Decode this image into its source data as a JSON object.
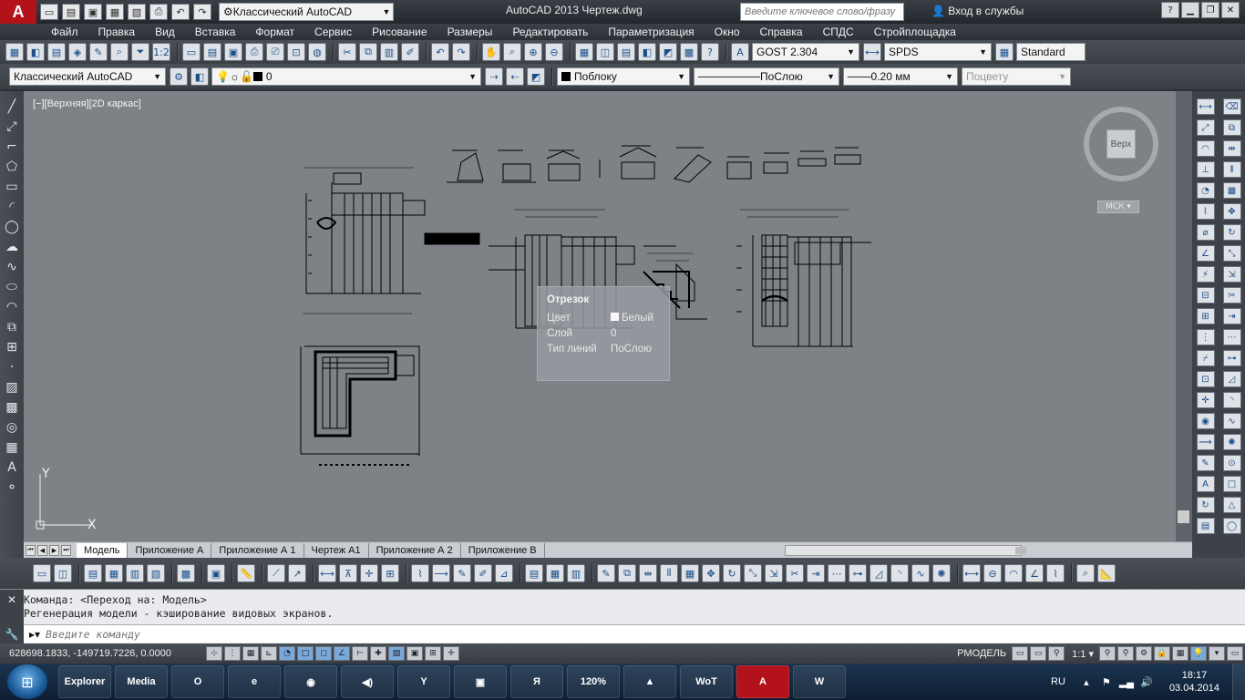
{
  "window": {
    "app_logo": "A",
    "title": "AutoCAD 2013    Чертеж.dwg",
    "search_placeholder": "Введите ключевое слово/фразу",
    "signin": "Вход в службы",
    "workspace": "Классический AutoCAD"
  },
  "menu": [
    "Файл",
    "Правка",
    "Вид",
    "Вставка",
    "Формат",
    "Сервис",
    "Рисование",
    "Размеры",
    "Редактировать",
    "Параметризация",
    "Окно",
    "Справка",
    "СПДС",
    "Стройплощадка"
  ],
  "toolbar1": {
    "scale_btn": "1:2",
    "text_style": "GOST 2.304",
    "dim_style": "SPDS",
    "table_style": "Standard"
  },
  "toolbar2": {
    "workspace": "Классический AutoCAD",
    "layer": "0",
    "color": "Поблоку",
    "linetype": "ПоСлою",
    "lineweight": "0.20 мм",
    "plotstyle": "Поцвету"
  },
  "canvas": {
    "viewport_label": "[−][Верхняя][2D каркас]",
    "viewcube_label": "Верх",
    "ucs_label": "МСК ▾",
    "ucs_x": "X",
    "ucs_y": "Y"
  },
  "tooltip": {
    "title": "Отрезок",
    "rows": [
      {
        "key": "Цвет",
        "value": "Белый"
      },
      {
        "key": "Слой",
        "value": "0"
      },
      {
        "key": "Тип линий",
        "value": "ПоСлою"
      }
    ]
  },
  "tabs": [
    "Модель",
    "Приложение А",
    "Приложение А 1",
    "Чертеж А1",
    "Приложение А 2",
    "Приложение В"
  ],
  "command": {
    "history_1": "Команда:   <Переход на: Модель>",
    "history_2": "Регенерация модели - кэширование видовых экранов.",
    "placeholder": "Введите команду"
  },
  "status": {
    "coords": "628698.1833, -149719.7226, 0.0000",
    "paper_mode": "РМОДЕЛЬ",
    "annotation_scale": "1:1 ▾"
  },
  "taskbar": {
    "apps": [
      {
        "label": "Explorer",
        "icon": "folder-icon"
      },
      {
        "label": "Media",
        "icon": "media-player-icon"
      },
      {
        "label": "O",
        "icon": "opera-icon"
      },
      {
        "label": "e",
        "icon": "internet-explorer-icon"
      },
      {
        "label": "◉",
        "icon": "chrome-icon"
      },
      {
        "label": "◀)",
        "icon": "audio-app-icon"
      },
      {
        "label": "Y",
        "icon": "yandex-browser-icon"
      },
      {
        "label": "▣",
        "icon": "save-disk-icon"
      },
      {
        "label": "Я",
        "icon": "yandex-icon"
      },
      {
        "label": "120%",
        "icon": "zoom-app-icon"
      },
      {
        "label": "▲",
        "icon": "avast-icon"
      },
      {
        "label": "WoT",
        "icon": "world-of-tanks-icon"
      },
      {
        "label": "A",
        "icon": "autocad-icon"
      },
      {
        "label": "W",
        "icon": "word-icon"
      }
    ],
    "lang": "RU",
    "time": "18:17",
    "date": "03.04.2014"
  },
  "colors": {
    "canvas": "#7e8287",
    "autocad_red": "#b3121b",
    "taskbar": "#1b3550"
  }
}
